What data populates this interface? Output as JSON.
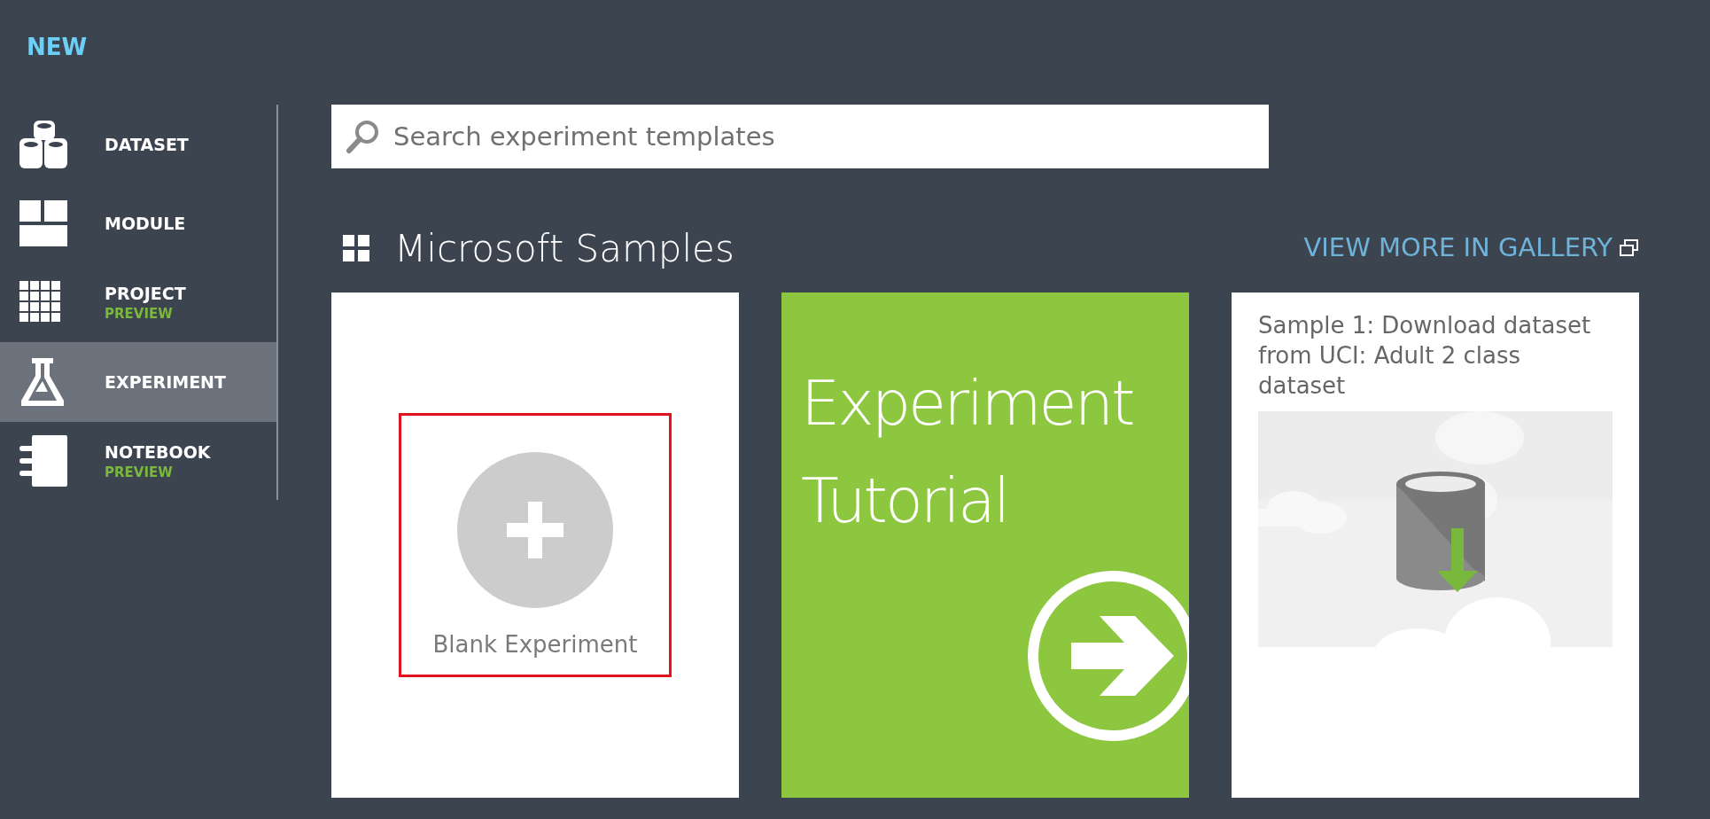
{
  "header": {
    "title": "NEW"
  },
  "sidebar": {
    "items": [
      {
        "kind": "dataset",
        "label": "DATASET",
        "selected": false
      },
      {
        "kind": "module",
        "label": "MODULE",
        "selected": false
      },
      {
        "kind": "project",
        "label": "PROJECT",
        "badge": "PREVIEW",
        "selected": false
      },
      {
        "kind": "experiment",
        "label": "EXPERIMENT",
        "selected": true
      },
      {
        "kind": "notebook",
        "label": "NOTEBOOK",
        "badge": "PREVIEW",
        "selected": false
      }
    ]
  },
  "search": {
    "placeholder": "Search experiment templates"
  },
  "section": {
    "title": "Microsoft Samples",
    "link": "VIEW MORE IN GALLERY"
  },
  "cards": [
    {
      "kind": "blank",
      "label": "Blank Experiment",
      "highlighted": true
    },
    {
      "kind": "tutorial",
      "lines": [
        "Experiment",
        "Tutorial"
      ]
    },
    {
      "kind": "sample",
      "title": "Sample 1: Download dataset from UCI: Adult 2 class dataset"
    }
  ]
}
